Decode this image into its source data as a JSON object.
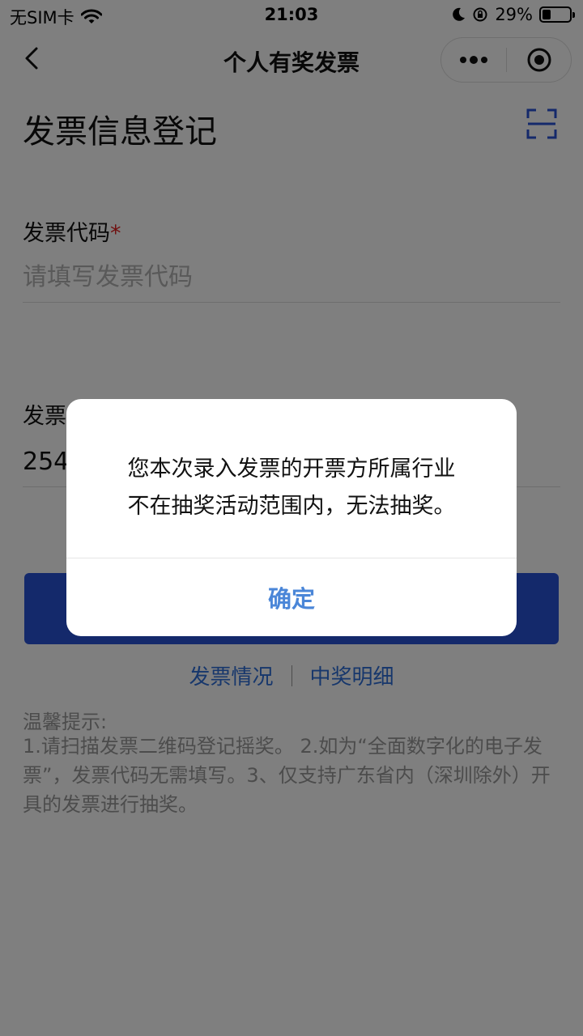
{
  "status_bar": {
    "carrier": "无SIM卡",
    "time": "21:03",
    "battery_percent_text": "29%",
    "battery_level": 0.29,
    "icons": [
      "wifi-icon",
      "moon-icon",
      "orientation-lock-icon",
      "battery-icon"
    ]
  },
  "nav": {
    "title": "个人有奖发票",
    "icons": [
      "back-chevron-icon",
      "more-dots-icon",
      "close-target-icon"
    ]
  },
  "page": {
    "title": "发票信息登记",
    "scan_icon": "scan-icon",
    "accent_color": "#2952d6"
  },
  "form": {
    "code_label": "发票代码",
    "code_required_mark": "*",
    "code_placeholder": "请填写发票代码",
    "code_value": "",
    "number_label": "发票",
    "number_value": "254"
  },
  "links": {
    "invoice_status": "发票情况",
    "prize_details": "中奖明细"
  },
  "tips": {
    "title": "温馨提示:",
    "text": "1.请扫描发票二维码登记摇奖。 2.如为“全面数字化的电子发票”，发票代码无需填写。3、仅支持广东省内（深圳除外）开具的发票进行抽奖。"
  },
  "dialog": {
    "line1": "您本次录入发票的开票方所属行业",
    "line2": "不在抽奖活动范围内，无法抽奖。",
    "confirm_label": "确定",
    "confirm_color": "#4a86d8"
  }
}
